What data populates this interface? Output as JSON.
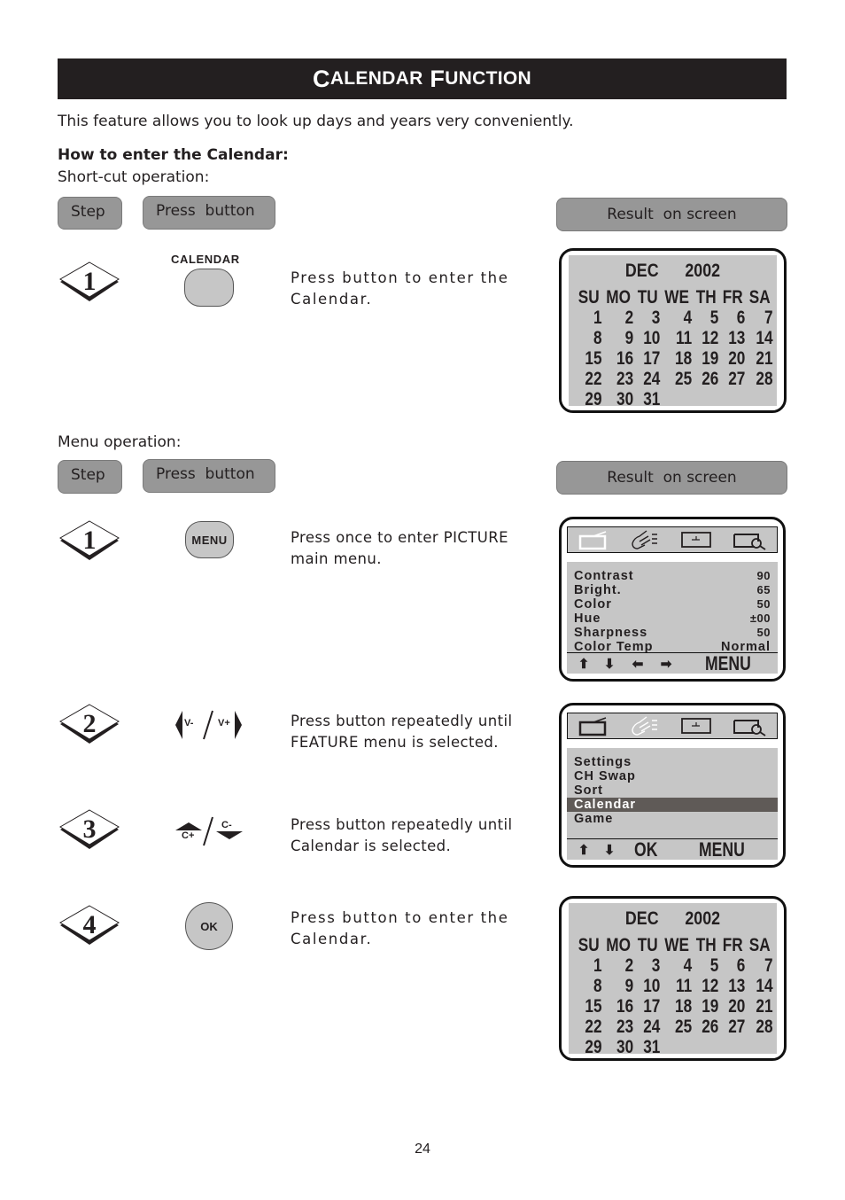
{
  "title": {
    "first_initial": "C",
    "first_rest": "ALENDAR",
    "second_initial": "F",
    "second_rest": "UNCTION"
  },
  "intro": "This feature allows you to look up days and years very conveniently.",
  "how_to_heading": "How to enter the Calendar:",
  "shortcut": {
    "label": "Short-cut operation:",
    "headers": {
      "step": "Step",
      "press": "Press  button",
      "result": "Result  on screen"
    },
    "steps": [
      {
        "number": "1",
        "button_caption": "CALENDAR",
        "button_label": "",
        "desc": [
          "Press button to enter the",
          "Calendar."
        ]
      }
    ]
  },
  "menu_op": {
    "label": "Menu operation:",
    "headers": {
      "step": "Step",
      "press": "Press  button",
      "result": "Result  on screen"
    },
    "steps": [
      {
        "number": "1",
        "button_label": "MENU",
        "desc": [
          "Press once to enter PICTURE",
          "main menu."
        ]
      },
      {
        "number": "2",
        "button_left": "V-",
        "button_right": "V+",
        "desc": [
          "Press button repeatedly until",
          "FEATURE menu is selected."
        ]
      },
      {
        "number": "3",
        "button_left": "C+",
        "button_right": "C-",
        "desc": [
          "Press button repeatedly until",
          "Calendar is selected."
        ]
      },
      {
        "number": "4",
        "button_label": "OK",
        "desc": [
          "Press button to enter the",
          "Calendar."
        ]
      }
    ]
  },
  "calendar": {
    "month": "DEC",
    "year": "2002",
    "weekdays": [
      "SU",
      "MO",
      "TU",
      "WE",
      "TH",
      "FR",
      "SA"
    ],
    "weeks": [
      [
        "1",
        "2",
        "3",
        "4",
        "5",
        "6",
        "7"
      ],
      [
        "8",
        "9",
        "10",
        "11",
        "12",
        "13",
        "14"
      ],
      [
        "15",
        "16",
        "17",
        "18",
        "19",
        "20",
        "21"
      ],
      [
        "22",
        "23",
        "24",
        "25",
        "26",
        "27",
        "28"
      ],
      [
        "29",
        "30",
        "31",
        "",
        "",
        "",
        ""
      ]
    ]
  },
  "picture_menu": {
    "icons": [
      "tv-icon",
      "hand-pointer-icon",
      "clock-icon",
      "magnifier-icon"
    ],
    "active_icon": "tv-icon",
    "rows": [
      {
        "label": "Contrast",
        "value": "90"
      },
      {
        "label": "Bright.",
        "value": "65"
      },
      {
        "label": "Color",
        "value": "50"
      },
      {
        "label": "Hue",
        "value": "±00"
      },
      {
        "label": "Sharpness",
        "value": "50"
      },
      {
        "label": "Color Temp",
        "value": "Normal"
      }
    ],
    "footer": {
      "arrows": [
        "⬆",
        "⬇",
        "⬅",
        "➡"
      ],
      "word": "MENU"
    }
  },
  "feature_menu": {
    "icons": [
      "tv-icon",
      "hand-pointer-icon",
      "clock-icon",
      "magnifier-icon"
    ],
    "active_icon": "hand-pointer-icon",
    "items": [
      "Settings",
      "CH Swap",
      "Sort",
      "Calendar",
      "Game"
    ],
    "selected": "Calendar",
    "footer": {
      "arrows": [
        "⬆",
        "⬇"
      ],
      "ok": "OK",
      "word": "MENU"
    }
  },
  "page_number": "24"
}
